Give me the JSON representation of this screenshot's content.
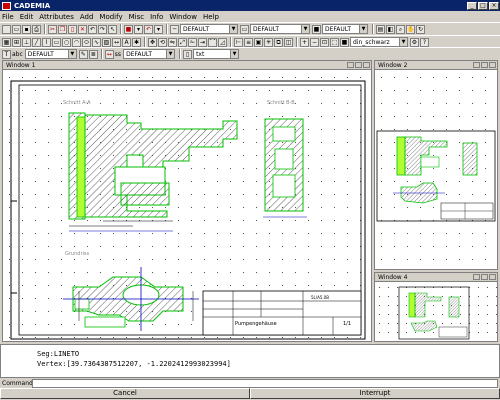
{
  "app": {
    "title": "CADEMIA"
  },
  "menu": [
    "File",
    "Edit",
    "Attributes",
    "Add",
    "Modify",
    "Misc",
    "Info",
    "Window",
    "Help"
  ],
  "toolbar": {
    "line_style_value": "DEFAULT",
    "layer_value": "DEFAULT",
    "pen_value": "DEFAULT",
    "color_value": "din_schwarz",
    "text_prefix": "abc",
    "text_style_value": "DEFAULT",
    "dim_prefix": "ss",
    "dim_style_value": "DEFAULT",
    "ext_value": "txt"
  },
  "windows": {
    "win1_title": "Window 1",
    "win2_title": "Window 2",
    "win4_title": "Window 4"
  },
  "drawing": {
    "label_section_aa": "Schnitt A-A",
    "label_section_bb": "Schnitt B-B",
    "label_plan": "Grundriss",
    "titleblock_name": "Pumpengehäuse",
    "titleblock_sheet": "1/1",
    "titleblock_number": "5L/A5.0B"
  },
  "output": {
    "line1": "Seg:LINETO",
    "line2": "Vertex:[39.7364387512207, -1.2202412993023994]"
  },
  "command": {
    "label": "Command:"
  },
  "buttons": {
    "cancel": "Cancel",
    "interrupt": "Interrupt"
  }
}
